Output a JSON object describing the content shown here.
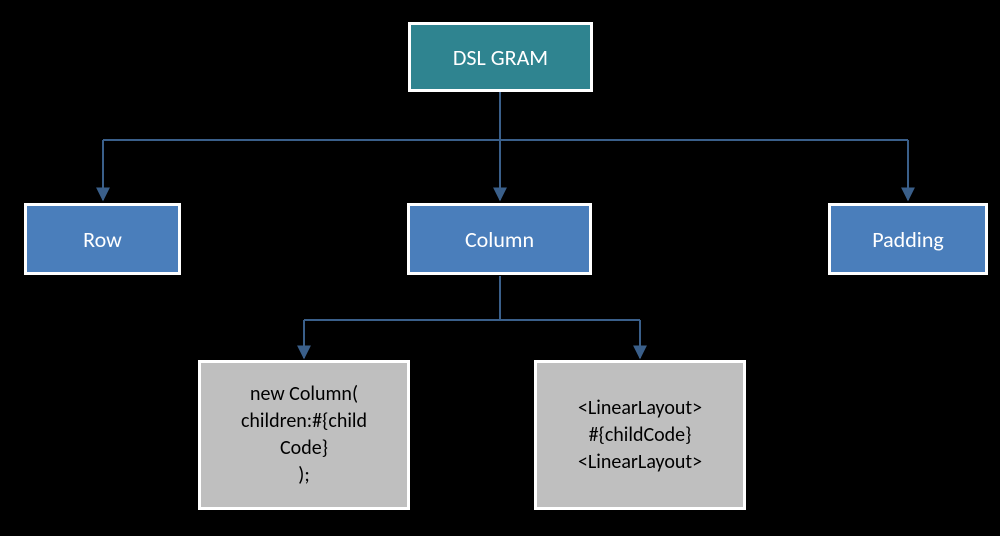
{
  "diagram": {
    "root": {
      "label": "DSL GRAM"
    },
    "level1": {
      "row": {
        "label": "Row"
      },
      "column": {
        "label": "Column"
      },
      "padding": {
        "label": "Padding"
      }
    },
    "level2": {
      "code_left": {
        "text": "new Column(\nchildren:#{child\nCode}\n);"
      },
      "code_right": {
        "text": "<LinearLayout>\n#{childCode}\n<LinearLayout>"
      }
    }
  },
  "colors": {
    "root": "#2f8490",
    "node": "#4a7ebb",
    "leaf": "#bfbfbf",
    "connector": "#3a5f8a",
    "background": "#000000"
  }
}
